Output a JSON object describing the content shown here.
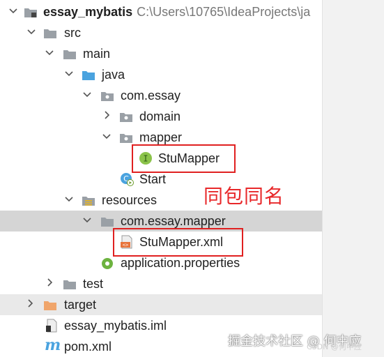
{
  "tree": {
    "project": {
      "name": "essay_mybatis",
      "path": "C:\\Users\\10765\\IdeaProjects\\ja"
    },
    "src": "src",
    "main": "main",
    "java": "java",
    "pkg": "com.essay",
    "domain": "domain",
    "mapper": "mapper",
    "stumapper": "StuMapper",
    "start": "Start",
    "resources": "resources",
    "res_pkg": "com.essay.mapper",
    "stumapper_xml": "StuMapper.xml",
    "app_props": "application.properties",
    "test": "test",
    "target": "target",
    "iml": "essay_mybatis.iml",
    "pom": "pom.xml"
  },
  "annotation": "同包同名",
  "watermark": {
    "text": "掘金技术社区 @ 何中应",
    "csdn": "CSDN @何中应"
  },
  "colors": {
    "accent_red": "#e02020",
    "folder": "#9aa0a6",
    "java_folder": "#4aa3df",
    "target_folder": "#f0a56b"
  }
}
